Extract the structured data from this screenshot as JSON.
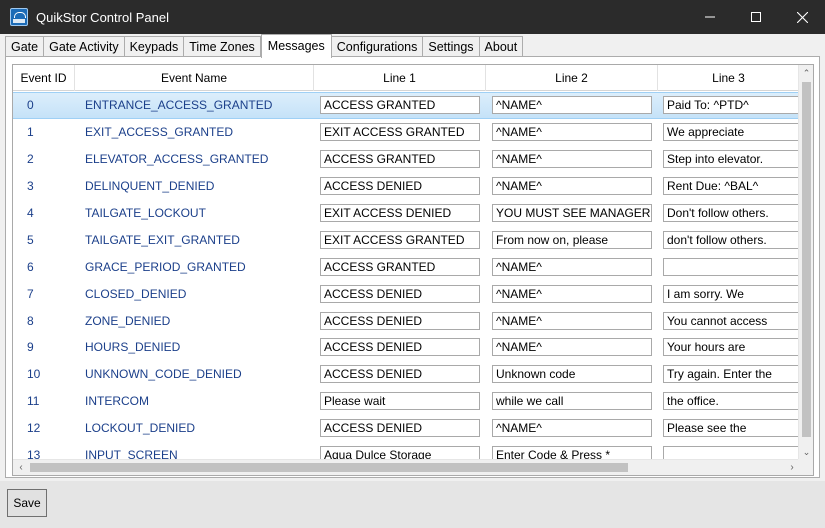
{
  "window": {
    "title": "QuikStor Control Panel"
  },
  "tabs": [
    {
      "label": "Gate"
    },
    {
      "label": "Gate Activity"
    },
    {
      "label": "Keypads"
    },
    {
      "label": "Time Zones"
    },
    {
      "label": "Messages"
    },
    {
      "label": "Configurations"
    },
    {
      "label": "Settings"
    },
    {
      "label": "About"
    }
  ],
  "active_tab": "Messages",
  "grid": {
    "columns": {
      "id": "Event ID",
      "name": "Event Name",
      "line1": "Line 1",
      "line2": "Line 2",
      "line3": "Line 3"
    },
    "rows": [
      {
        "id": "0",
        "name": "ENTRANCE_ACCESS_GRANTED",
        "line1": "ACCESS GRANTED",
        "line2": "^NAME^",
        "line3": "Paid To: ^PTD^"
      },
      {
        "id": "1",
        "name": "EXIT_ACCESS_GRANTED",
        "line1": "EXIT ACCESS GRANTED",
        "line2": "^NAME^",
        "line3": "We appreciate"
      },
      {
        "id": "2",
        "name": "ELEVATOR_ACCESS_GRANTED",
        "line1": "ACCESS GRANTED",
        "line2": "^NAME^",
        "line3": "Step into elevator."
      },
      {
        "id": "3",
        "name": "DELINQUENT_DENIED",
        "line1": "ACCESS DENIED",
        "line2": "^NAME^",
        "line3": "Rent Due: ^BAL^"
      },
      {
        "id": "4",
        "name": "TAILGATE_LOCKOUT",
        "line1": "EXIT ACCESS DENIED",
        "line2": "YOU MUST SEE MANAGER",
        "line3": "Don't follow others."
      },
      {
        "id": "5",
        "name": "TAILGATE_EXIT_GRANTED",
        "line1": "EXIT ACCESS GRANTED",
        "line2": "From now on, please",
        "line3": "don't follow others."
      },
      {
        "id": "6",
        "name": "GRACE_PERIOD_GRANTED",
        "line1": "ACCESS GRANTED",
        "line2": "^NAME^",
        "line3": ""
      },
      {
        "id": "7",
        "name": "CLOSED_DENIED",
        "line1": "ACCESS DENIED",
        "line2": "^NAME^",
        "line3": "I am sorry. We"
      },
      {
        "id": "8",
        "name": "ZONE_DENIED",
        "line1": "ACCESS DENIED",
        "line2": "^NAME^",
        "line3": "You cannot access"
      },
      {
        "id": "9",
        "name": "HOURS_DENIED",
        "line1": "ACCESS DENIED",
        "line2": "^NAME^",
        "line3": "Your hours are"
      },
      {
        "id": "10",
        "name": "UNKNOWN_CODE_DENIED",
        "line1": "ACCESS DENIED",
        "line2": "Unknown code",
        "line3": "Try again. Enter the"
      },
      {
        "id": "11",
        "name": "INTERCOM",
        "line1": "Please wait",
        "line2": "while we call",
        "line3": "the office."
      },
      {
        "id": "12",
        "name": "LOCKOUT_DENIED",
        "line1": "ACCESS DENIED",
        "line2": "^NAME^",
        "line3": "Please see the"
      },
      {
        "id": "13",
        "name": "INPUT_SCREEN",
        "line1": "Aqua Dulce Storage",
        "line2": "Enter Code & Press *",
        "line3": ""
      }
    ]
  },
  "footer": {
    "save_label": "Save"
  },
  "colors": {
    "titlebar": "#2b2b2b",
    "row_text": "#1b3f8a",
    "selected_row": "#cce8ff"
  }
}
